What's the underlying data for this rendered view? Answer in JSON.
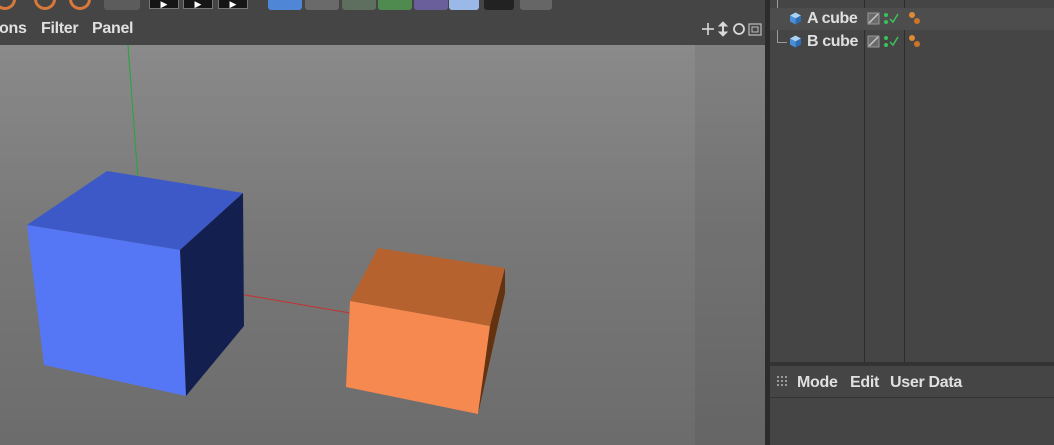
{
  "viewport": {
    "menu": [
      {
        "id": "options",
        "label": "ons"
      },
      {
        "id": "filter",
        "label": "Filter"
      },
      {
        "id": "panel",
        "label": "Panel"
      }
    ],
    "nav_icons": [
      "move-icon",
      "scroll-icon",
      "rotate-icon",
      "maximize-icon"
    ]
  },
  "object_manager": {
    "objects": [
      {
        "name": "A cube",
        "icon": "cube-icon",
        "selected": true
      },
      {
        "name": "B cube",
        "icon": "cube-icon",
        "selected": false
      }
    ]
  },
  "attribute_manager": {
    "menu": [
      {
        "id": "mode",
        "label": "Mode"
      },
      {
        "id": "edit",
        "label": "Edit"
      },
      {
        "id": "user_data",
        "label": "User Data"
      }
    ]
  },
  "colors": {
    "cube_a_front": "#5577f5",
    "cube_a_top": "#3d59c7",
    "cube_a_side": "#13204f",
    "cube_b_front": "#f5894f",
    "cube_b_top": "#b6622f",
    "cube_b_side": "#64320e"
  }
}
